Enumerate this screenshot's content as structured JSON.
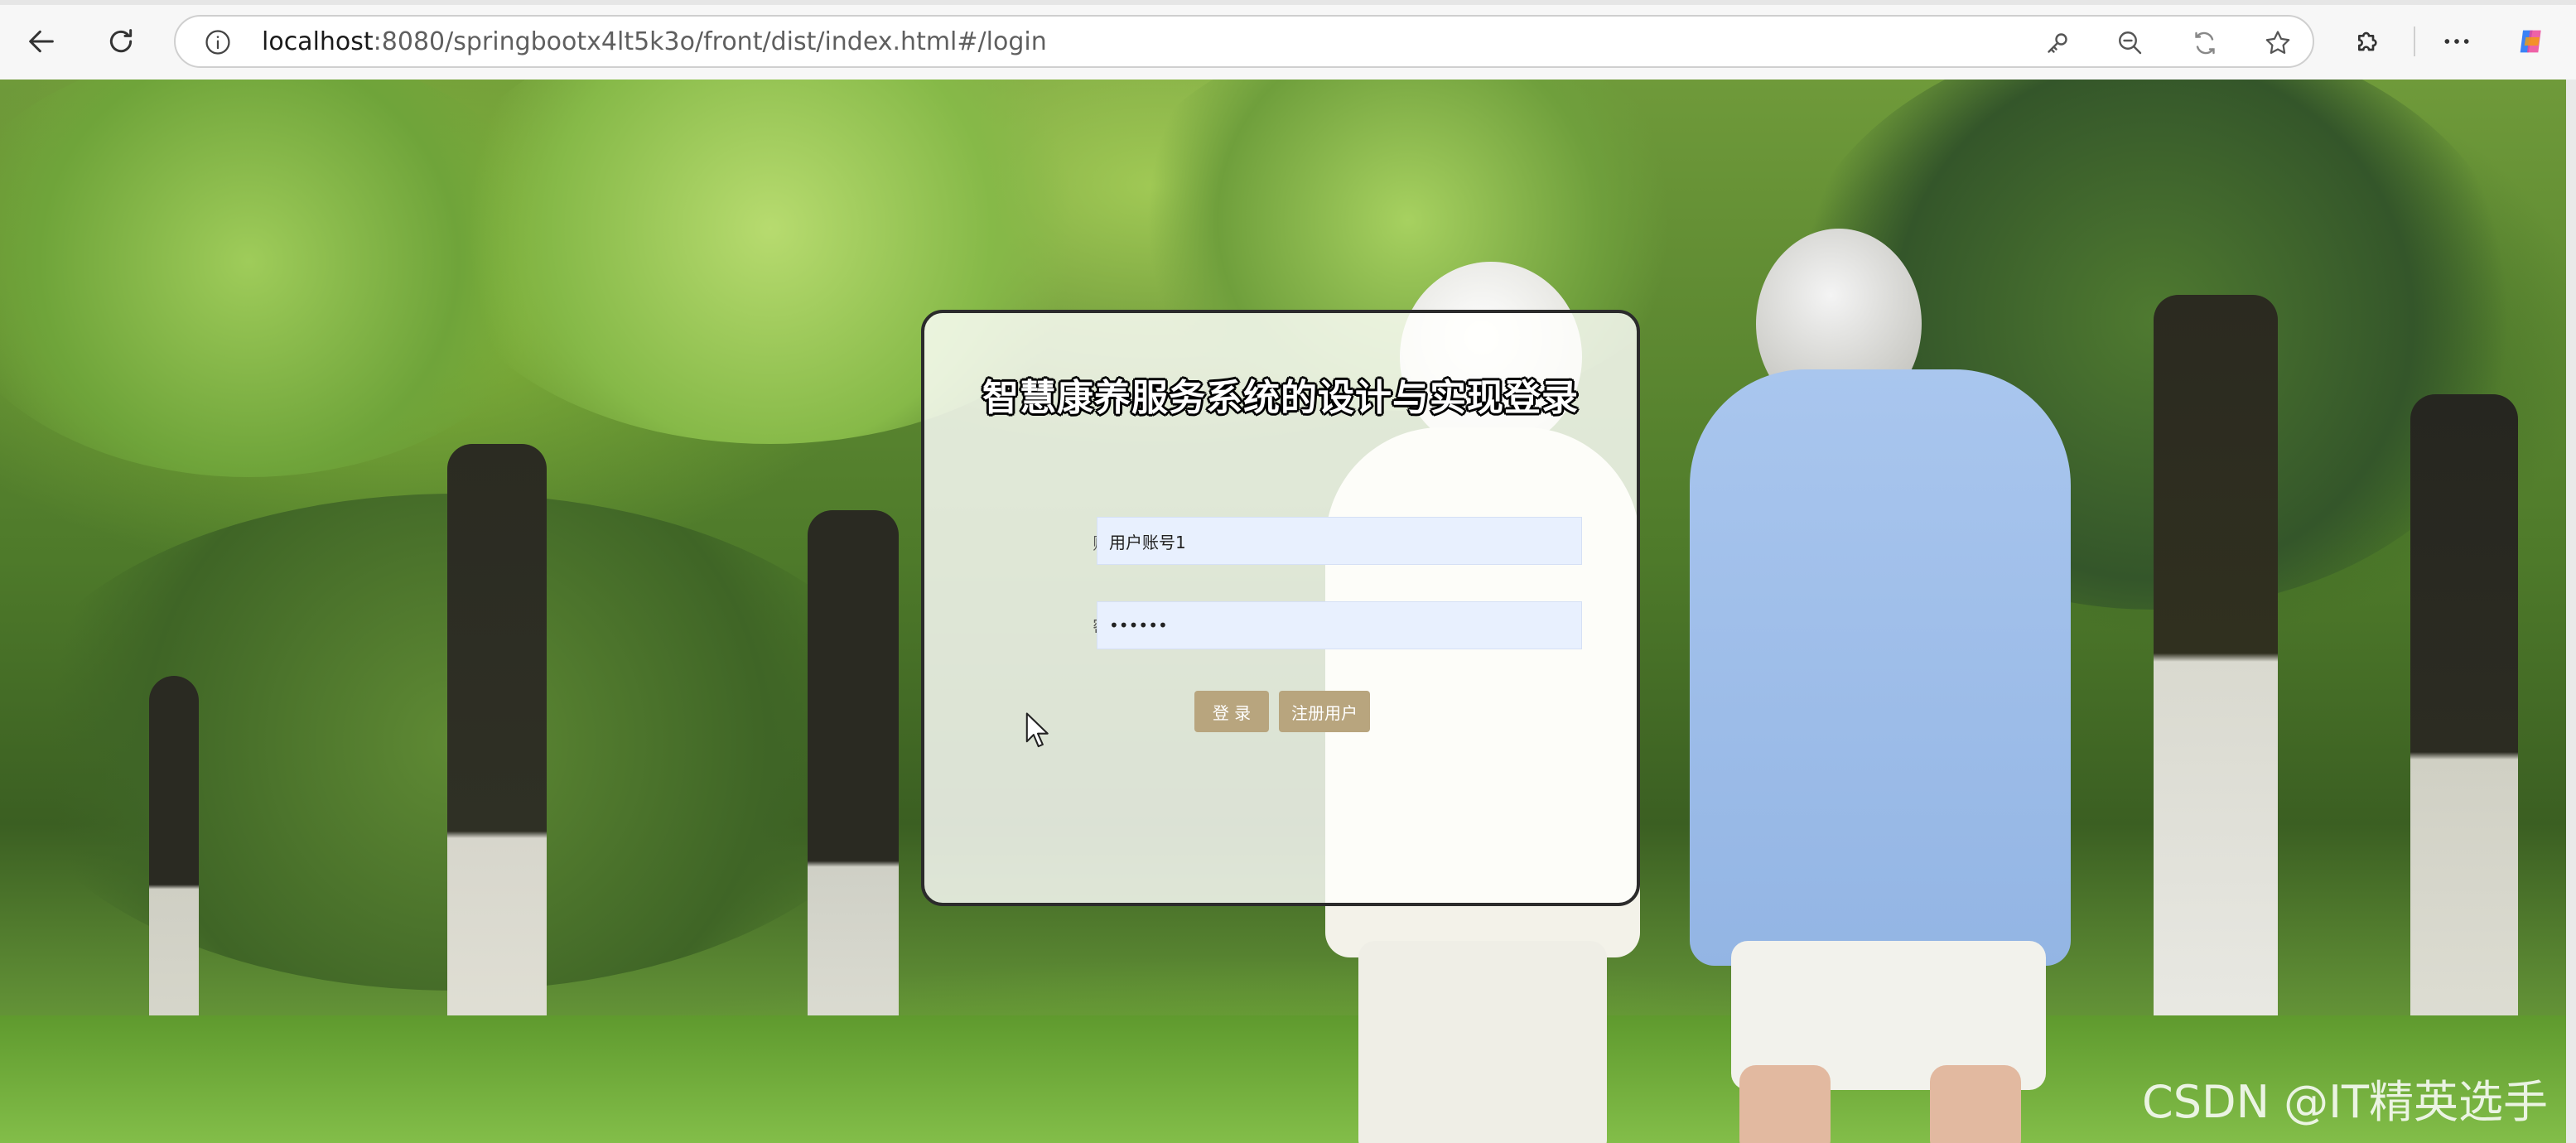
{
  "browser": {
    "url_host": "localhost",
    "url_rest": ":8080/springbootx4lt5k3o/front/dist/index.html#/login",
    "icons": {
      "back": "arrow-left-icon",
      "refresh": "refresh-icon",
      "site_info": "info-icon",
      "password_key": "key-icon",
      "zoom_out": "zoom-out-icon",
      "translate": "translate-icon",
      "favorite": "star-icon",
      "extensions": "puzzle-icon",
      "more": "more-dots-icon",
      "copilot": "copilot-icon"
    }
  },
  "login": {
    "title": "智慧康养服务系统的设计与实现登录",
    "account_label": "账号:",
    "account_value": "用户账号1",
    "password_label": "密码:",
    "password_value": "••••••",
    "login_button": "登 录",
    "register_button": "注册用户"
  },
  "watermark": "CSDN @IT精英选手",
  "colors": {
    "button_bg": "#b8a57e",
    "input_bg": "#e8f0fe",
    "panel_border": "#2b2b2b"
  }
}
